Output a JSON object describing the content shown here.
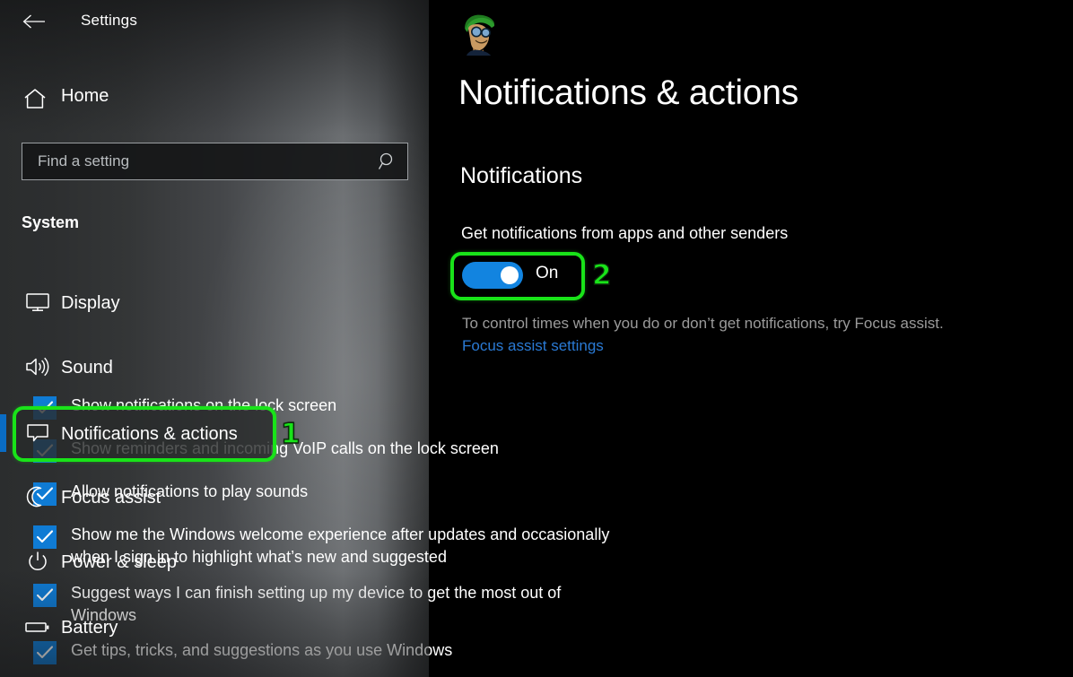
{
  "window": {
    "title": "Settings",
    "back_icon": "back-arrow-icon"
  },
  "sidebar": {
    "home_label": "Home",
    "home_icon": "home-icon",
    "search": {
      "placeholder": "Find a setting",
      "value": "",
      "icon": "search-icon"
    },
    "group_header": "System",
    "items": [
      {
        "label": "Display",
        "icon": "monitor-icon",
        "selected": false
      },
      {
        "label": "Sound",
        "icon": "speaker-icon",
        "selected": false
      },
      {
        "label": "Notifications & actions",
        "icon": "speech-bubble-icon",
        "selected": true
      },
      {
        "label": "Focus assist",
        "icon": "moon-icon",
        "selected": false
      },
      {
        "label": "Power & sleep",
        "icon": "power-icon",
        "selected": false
      },
      {
        "label": "Battery",
        "icon": "battery-icon",
        "selected": false
      }
    ]
  },
  "main": {
    "avatar_icon": "user-avatar-cartoon",
    "page_title": "Notifications & actions",
    "section_heading": "Notifications",
    "primary_setting_label": "Get notifications from apps and other senders",
    "toggle": {
      "state_label": "On",
      "checked": true
    },
    "hint_text": "To control times when you do or don’t get notifications, try Focus assist.",
    "link_label": "Focus assist settings",
    "checkboxes": [
      {
        "label": "Show notifications on the lock screen",
        "checked": true
      },
      {
        "label": "Show reminders and incoming VoIP calls on the lock screen",
        "checked": true
      },
      {
        "label": "Allow notifications to play sounds",
        "checked": true
      },
      {
        "label": "Show me the Windows welcome experience after updates and occasionally when I sign in to highlight what’s new and suggested",
        "checked": true
      },
      {
        "label": "Suggest ways I can finish setting up my device to get the most out of Windows",
        "checked": true
      },
      {
        "label": "Get tips, tricks, and suggestions as you use Windows",
        "checked": true
      }
    ]
  },
  "annotations": {
    "markers": [
      {
        "number": "1",
        "target": "sidebar-item-notifications-actions"
      },
      {
        "number": "2",
        "target": "notifications-toggle"
      }
    ],
    "highlight_color": "#19e319"
  },
  "colors": {
    "accent_blue": "#0f7bd4",
    "toggle_blue": "#1284e0",
    "link_blue": "#2a7ad4",
    "selection_indicator": "#0a6cc4",
    "callout_green": "#19e319"
  }
}
